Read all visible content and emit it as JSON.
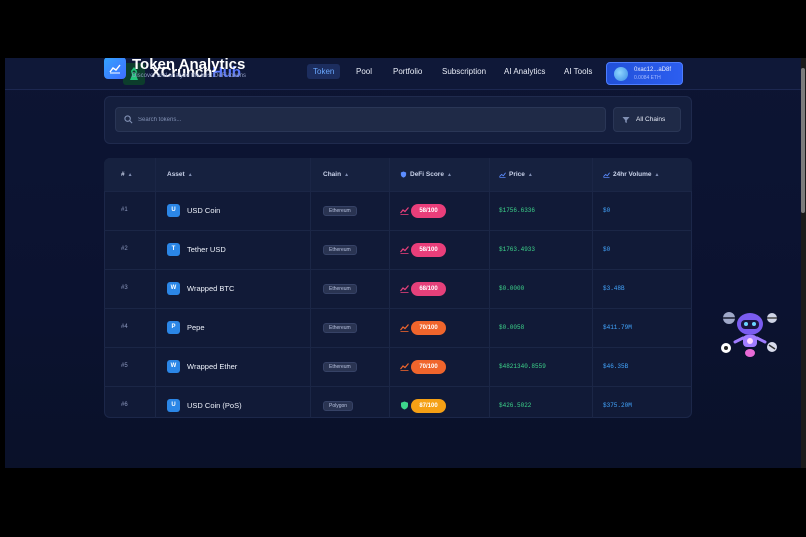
{
  "nav": {
    "brand_a": "XCrunch",
    "brand_b": "Hub",
    "items": [
      {
        "label": "Token",
        "active": true
      },
      {
        "label": "Pool",
        "active": false
      },
      {
        "label": "Portfolio",
        "active": false
      },
      {
        "label": "Subscription",
        "active": false
      },
      {
        "label": "AI Analytics",
        "active": false
      },
      {
        "label": "AI Tools",
        "active": false
      }
    ],
    "wallet": {
      "address": "0xac12...aD8f",
      "balance": "0.0084 ETH"
    }
  },
  "header": {
    "title": "Token Analytics",
    "subtitle": "Discover and analyze the best DeFi tokens",
    "icon": "chart-icon"
  },
  "search": {
    "placeholder": "Search tokens...",
    "chains_label": "All Chains"
  },
  "table": {
    "columns": [
      {
        "label": "#"
      },
      {
        "label": "Asset"
      },
      {
        "label": "Chain"
      },
      {
        "label": "DeFi Score",
        "icon": "shield-icon"
      },
      {
        "label": "Price",
        "icon": "chart-icon"
      },
      {
        "label": "24hr Volume",
        "icon": "chart-icon"
      }
    ],
    "rows": [
      {
        "rank": "#1",
        "letter": "U",
        "name": "USD Coin",
        "chain": "Ethereum",
        "score": "58/100",
        "score_color": "#e93e7a",
        "price": "$1756.6336",
        "volume": "$0"
      },
      {
        "rank": "#2",
        "letter": "T",
        "name": "Tether USD",
        "chain": "Ethereum",
        "score": "58/100",
        "score_color": "#e93e7a",
        "price": "$1763.4933",
        "volume": "$0"
      },
      {
        "rank": "#3",
        "letter": "W",
        "name": "Wrapped BTC",
        "chain": "Ethereum",
        "score": "68/100",
        "score_color": "#e5407a",
        "price": "$0.0000",
        "volume": "$3.48B"
      },
      {
        "rank": "#4",
        "letter": "P",
        "name": "Pepe",
        "chain": "Ethereum",
        "score": "70/100",
        "score_color": "#f0652c",
        "price": "$0.0058",
        "volume": "$411.79M"
      },
      {
        "rank": "#5",
        "letter": "W",
        "name": "Wrapped Ether",
        "chain": "Ethereum",
        "score": "70/100",
        "score_color": "#f0652c",
        "price": "$4821340.8559",
        "volume": "$46.35B"
      },
      {
        "rank": "#6",
        "letter": "U",
        "name": "USD Coin (PoS)",
        "chain": "Polygon",
        "score": "87/100",
        "score_color": "#f5a015",
        "price": "$426.5022",
        "volume": "$375.20M"
      }
    ]
  },
  "colors": {
    "accent": "#5b7bff",
    "price_green": "#3dd68c",
    "volume_blue": "#43a6ff"
  }
}
